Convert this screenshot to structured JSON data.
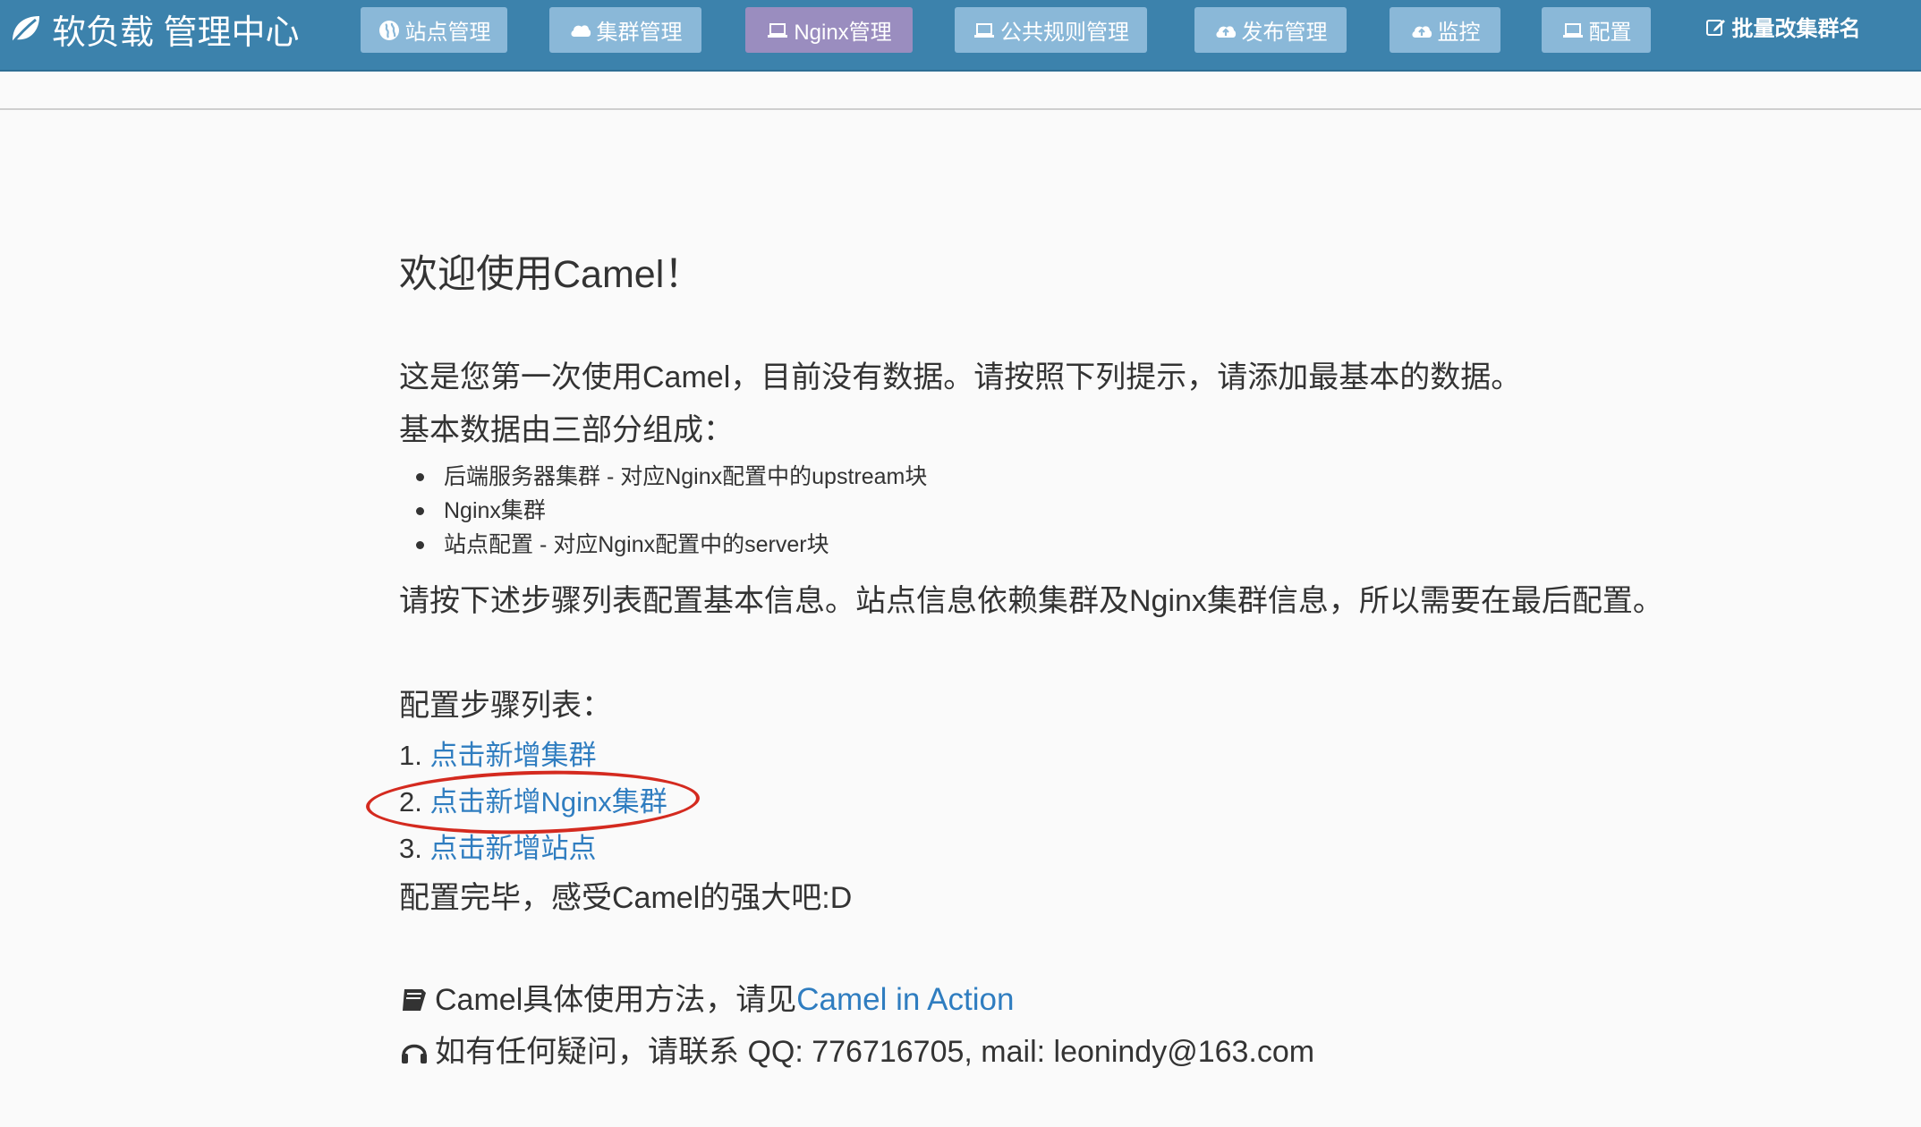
{
  "brand": {
    "title": "软负载 管理中心"
  },
  "nav": [
    {
      "label": "站点管理",
      "icon": "globe-icon"
    },
    {
      "label": "集群管理",
      "icon": "cloud-icon"
    },
    {
      "label": "Nginx管理",
      "icon": "laptop-icon"
    },
    {
      "label": "公共规则管理",
      "icon": "laptop-icon"
    },
    {
      "label": "发布管理",
      "icon": "cloud-upload-icon"
    },
    {
      "label": "监控",
      "icon": "cloud-upload-icon"
    },
    {
      "label": "配置",
      "icon": "laptop-icon"
    },
    {
      "label": "批量改集群名",
      "icon": "edit-icon"
    }
  ],
  "main": {
    "welcome": "欢迎使用Camel！",
    "intro": "这是您第一次使用Camel，目前没有数据。请按照下列提示，请添加最基本的数据。",
    "composition": "基本数据由三部分组成：",
    "parts": [
      "后端服务器集群 - 对应Nginx配置中的upstream块",
      "Nginx集群",
      "站点配置 - 对应Nginx配置中的server块"
    ],
    "instruction": "请按下述步骤列表配置基本信息。站点信息依赖集群及Nginx集群信息，所以需要在最后配置。",
    "steps_heading": "配置步骤列表：",
    "steps": [
      {
        "num": "1.",
        "link": "点击新增集群"
      },
      {
        "num": "2.",
        "link": "点击新增Nginx集群"
      },
      {
        "num": "3.",
        "link": "点击新增站点"
      }
    ],
    "done": "配置完毕，感受Camel的强大吧:D",
    "docs_prefix": "Camel具体使用方法，请见",
    "docs_link": "Camel in Action",
    "contact": "如有任何疑问，请联系 QQ: 776716705, mail: leonindy@163.com"
  },
  "colors": {
    "navbar": "#3c82ac",
    "nav_button": "#8ab8d8",
    "nav_active": "#9a8dbf",
    "link": "#2f7dc0",
    "annotation": "#d42a1f"
  }
}
